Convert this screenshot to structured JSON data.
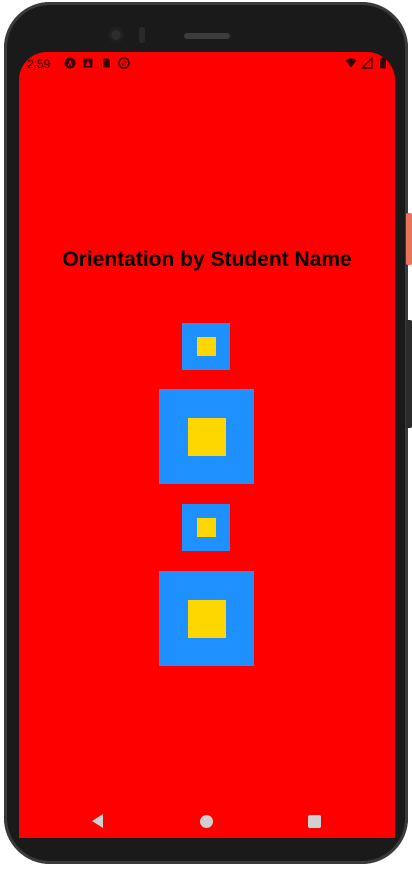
{
  "status_bar": {
    "time": "2:59",
    "left_icons": [
      "notification-a-icon",
      "notification-android-icon",
      "sd-card-icon",
      "sync-icon"
    ],
    "right_icons": [
      "wifi-icon",
      "signal-icon",
      "battery-icon"
    ]
  },
  "screen": {
    "background_color": "#ff0000",
    "title": "Orientation by Student Name"
  },
  "boxes": [
    {
      "outer_color": "#1e90ff",
      "inner_color": "#ffd700"
    },
    {
      "outer_color": "#1e90ff",
      "inner_color": "#ffd700"
    },
    {
      "outer_color": "#1e90ff",
      "inner_color": "#ffd700"
    },
    {
      "outer_color": "#1e90ff",
      "inner_color": "#ffd700"
    }
  ],
  "nav_bar": {
    "buttons": [
      "back-icon",
      "home-icon",
      "recents-icon"
    ]
  }
}
